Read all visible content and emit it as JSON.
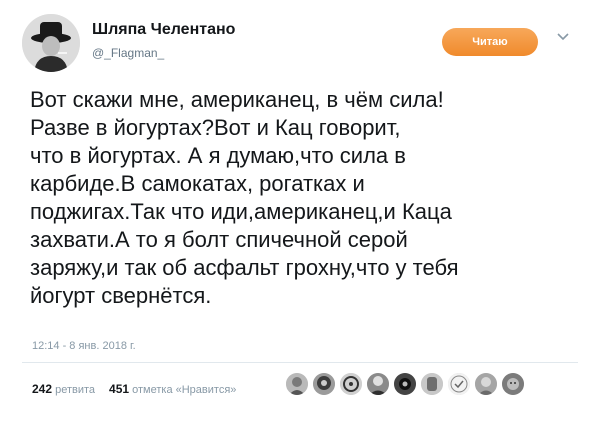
{
  "user": {
    "display_name": "Шляпа Челентано",
    "handle": "@_Flagman_"
  },
  "follow_button": {
    "label": "Читаю",
    "color": "#f08a2c"
  },
  "tweet": {
    "lines": [
      "Вот скажи мне, американец, в чём сила!",
      "Разве в йогуртах?Вот и Кац говорит,",
      "что в йогуртах. А я думаю,что сила в",
      "карбиде.В самокатах, рогатках и",
      "поджигах.Так что иди,американец,и Каца",
      "захвати.А то я болт спичечной серой",
      "заряжу,и так об асфальт грохну,что у тебя",
      "йогурт свернётся."
    ],
    "timestamp": "12:14 - 8 янв. 2018 г."
  },
  "stats": {
    "retweets_count": "242",
    "retweets_label": "ретвита",
    "likes_count": "451",
    "likes_label": "отметка «Нравится»"
  },
  "liker_avatars": [
    "user-avatar-1",
    "user-avatar-2",
    "user-avatar-3",
    "user-avatar-4",
    "user-avatar-5",
    "user-avatar-6",
    "user-avatar-7",
    "user-avatar-8",
    "user-avatar-9"
  ]
}
